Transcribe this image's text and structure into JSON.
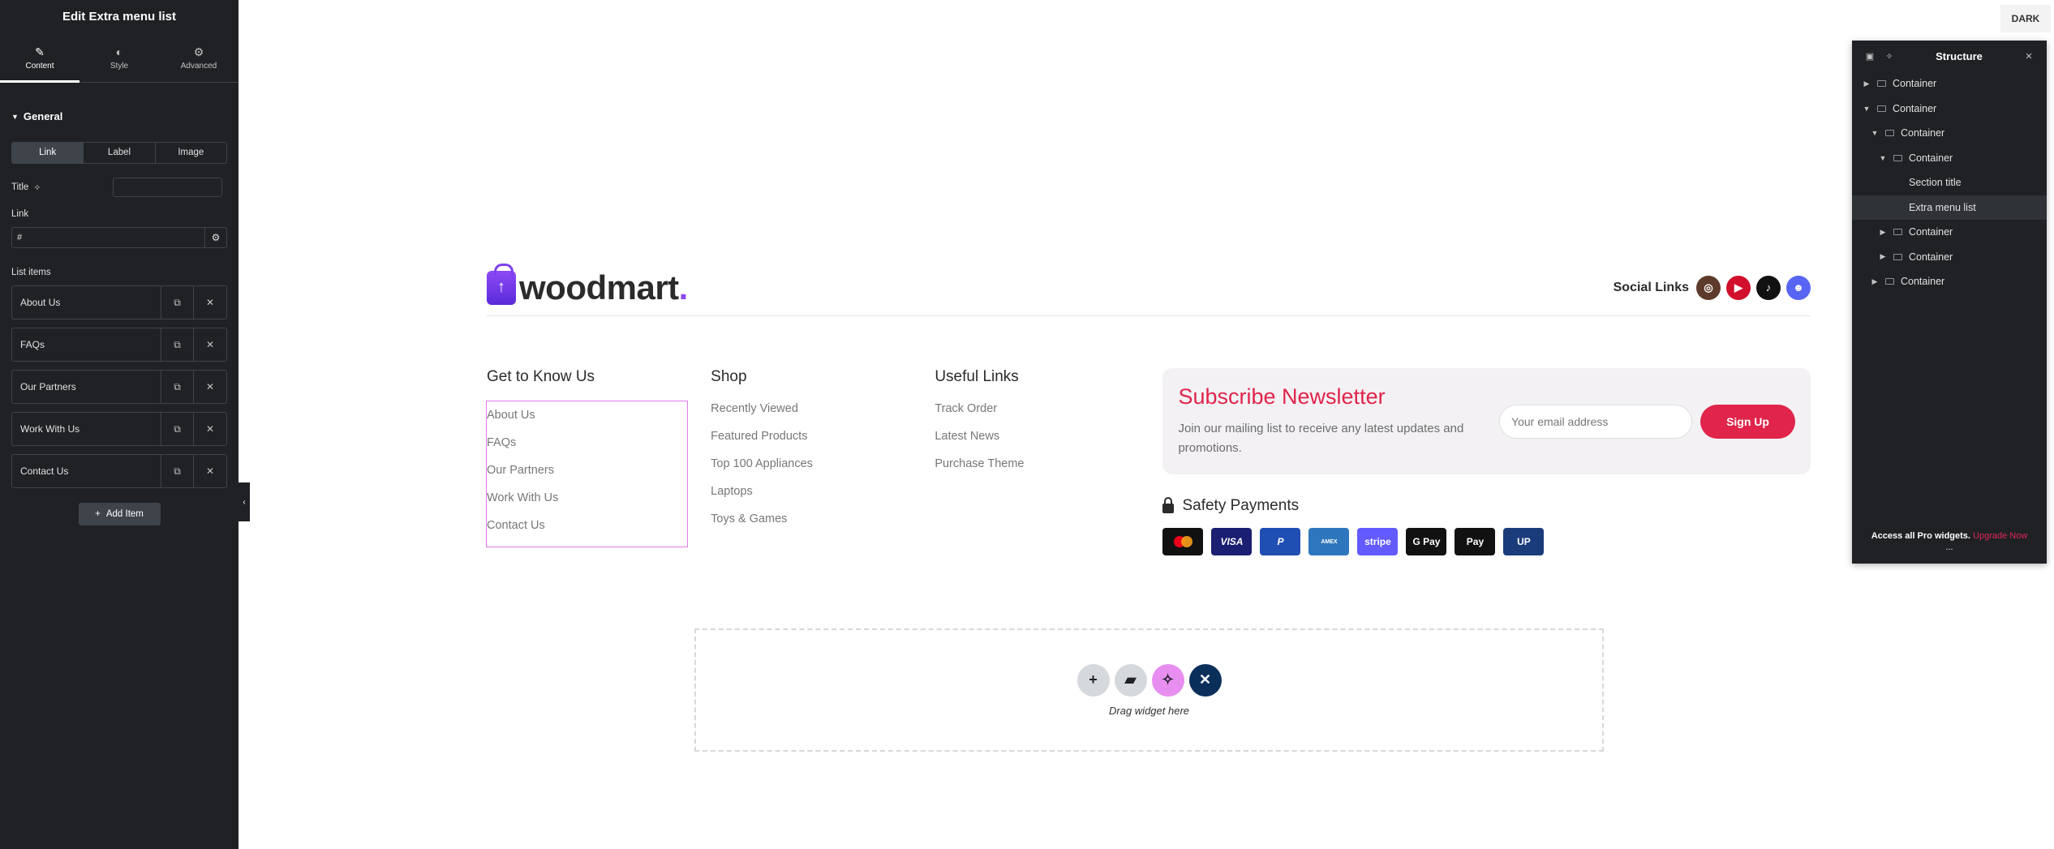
{
  "panel": {
    "title": "Edit Extra menu list",
    "tabs": [
      {
        "label": "Content",
        "icon": "pencil-icon"
      },
      {
        "label": "Style",
        "icon": "contrast-icon"
      },
      {
        "label": "Advanced",
        "icon": "gear-icon"
      }
    ],
    "section_title": "General",
    "segments": [
      "Link",
      "Label",
      "Image"
    ],
    "title_label": "Title",
    "link_label": "Link",
    "link_value": "#",
    "list_items_label": "List items",
    "items": [
      "About Us",
      "FAQs",
      "Our Partners",
      "Work With Us",
      "Contact Us"
    ],
    "add_item_label": "Add Item"
  },
  "canvas": {
    "dark_button": "DARK",
    "logo_text": "woodmart",
    "logo_dot": ".",
    "social_label": "Social Links",
    "social_icons": [
      {
        "name": "instagram-icon",
        "color": "#5d3a2a"
      },
      {
        "name": "youtube-icon",
        "color": "#d10f2c"
      },
      {
        "name": "tiktok-icon",
        "color": "#111111"
      },
      {
        "name": "discord-icon",
        "color": "#5865f2"
      }
    ],
    "columns": [
      {
        "title": "Get to Know Us",
        "links": [
          "About Us",
          "FAQs",
          "Our Partners",
          "Work With Us",
          "Contact Us"
        ]
      },
      {
        "title": "Shop",
        "links": [
          "Recently Viewed",
          "Featured Products",
          "Top 100 Appliances",
          "Laptops",
          "Toys & Games"
        ]
      },
      {
        "title": "Useful Links",
        "links": [
          "Track Order",
          "Latest News",
          "Purchase Theme"
        ]
      }
    ],
    "newsletter": {
      "title": "Subscribe Newsletter",
      "text": "Join our mailing list to receive any latest updates and promotions.",
      "placeholder": "Your email address",
      "button": "Sign Up"
    },
    "safety_title": "Safety Payments",
    "payments": [
      {
        "name": "mastercard-icon",
        "color": "#111111"
      },
      {
        "name": "visa-icon",
        "color": "#1a1f71"
      },
      {
        "name": "paypal-icon",
        "color": "#1f4fb3"
      },
      {
        "name": "amex-icon",
        "color": "#2e77bc"
      },
      {
        "name": "stripe-icon",
        "color": "#635bff"
      },
      {
        "name": "google-pay-icon",
        "color": "#111111"
      },
      {
        "name": "apple-pay-icon",
        "color": "#111111"
      },
      {
        "name": "unionpay-icon",
        "color": "#1b3c7b"
      }
    ],
    "dropzone_text": "Drag widget here"
  },
  "structure": {
    "title": "Structure",
    "nodes": [
      {
        "label": "Container",
        "depth": 0,
        "arrow": "right",
        "box": true
      },
      {
        "label": "Container",
        "depth": 0,
        "arrow": "down",
        "box": true
      },
      {
        "label": "Container",
        "depth": 1,
        "arrow": "down",
        "box": true
      },
      {
        "label": "Container",
        "depth": 2,
        "arrow": "down",
        "box": true
      },
      {
        "label": "Section title",
        "depth": 3,
        "arrow": "",
        "box": false
      },
      {
        "label": "Extra menu list",
        "depth": 3,
        "arrow": "",
        "box": false,
        "selected": true
      },
      {
        "label": "Container",
        "depth": 2,
        "arrow": "right",
        "box": true
      },
      {
        "label": "Container",
        "depth": 2,
        "arrow": "right",
        "box": true
      },
      {
        "label": "Container",
        "depth": 1,
        "arrow": "right",
        "box": true
      }
    ],
    "footer_text": "Access all Pro widgets.",
    "footer_link": "Upgrade Now",
    "footer_more": "..."
  }
}
